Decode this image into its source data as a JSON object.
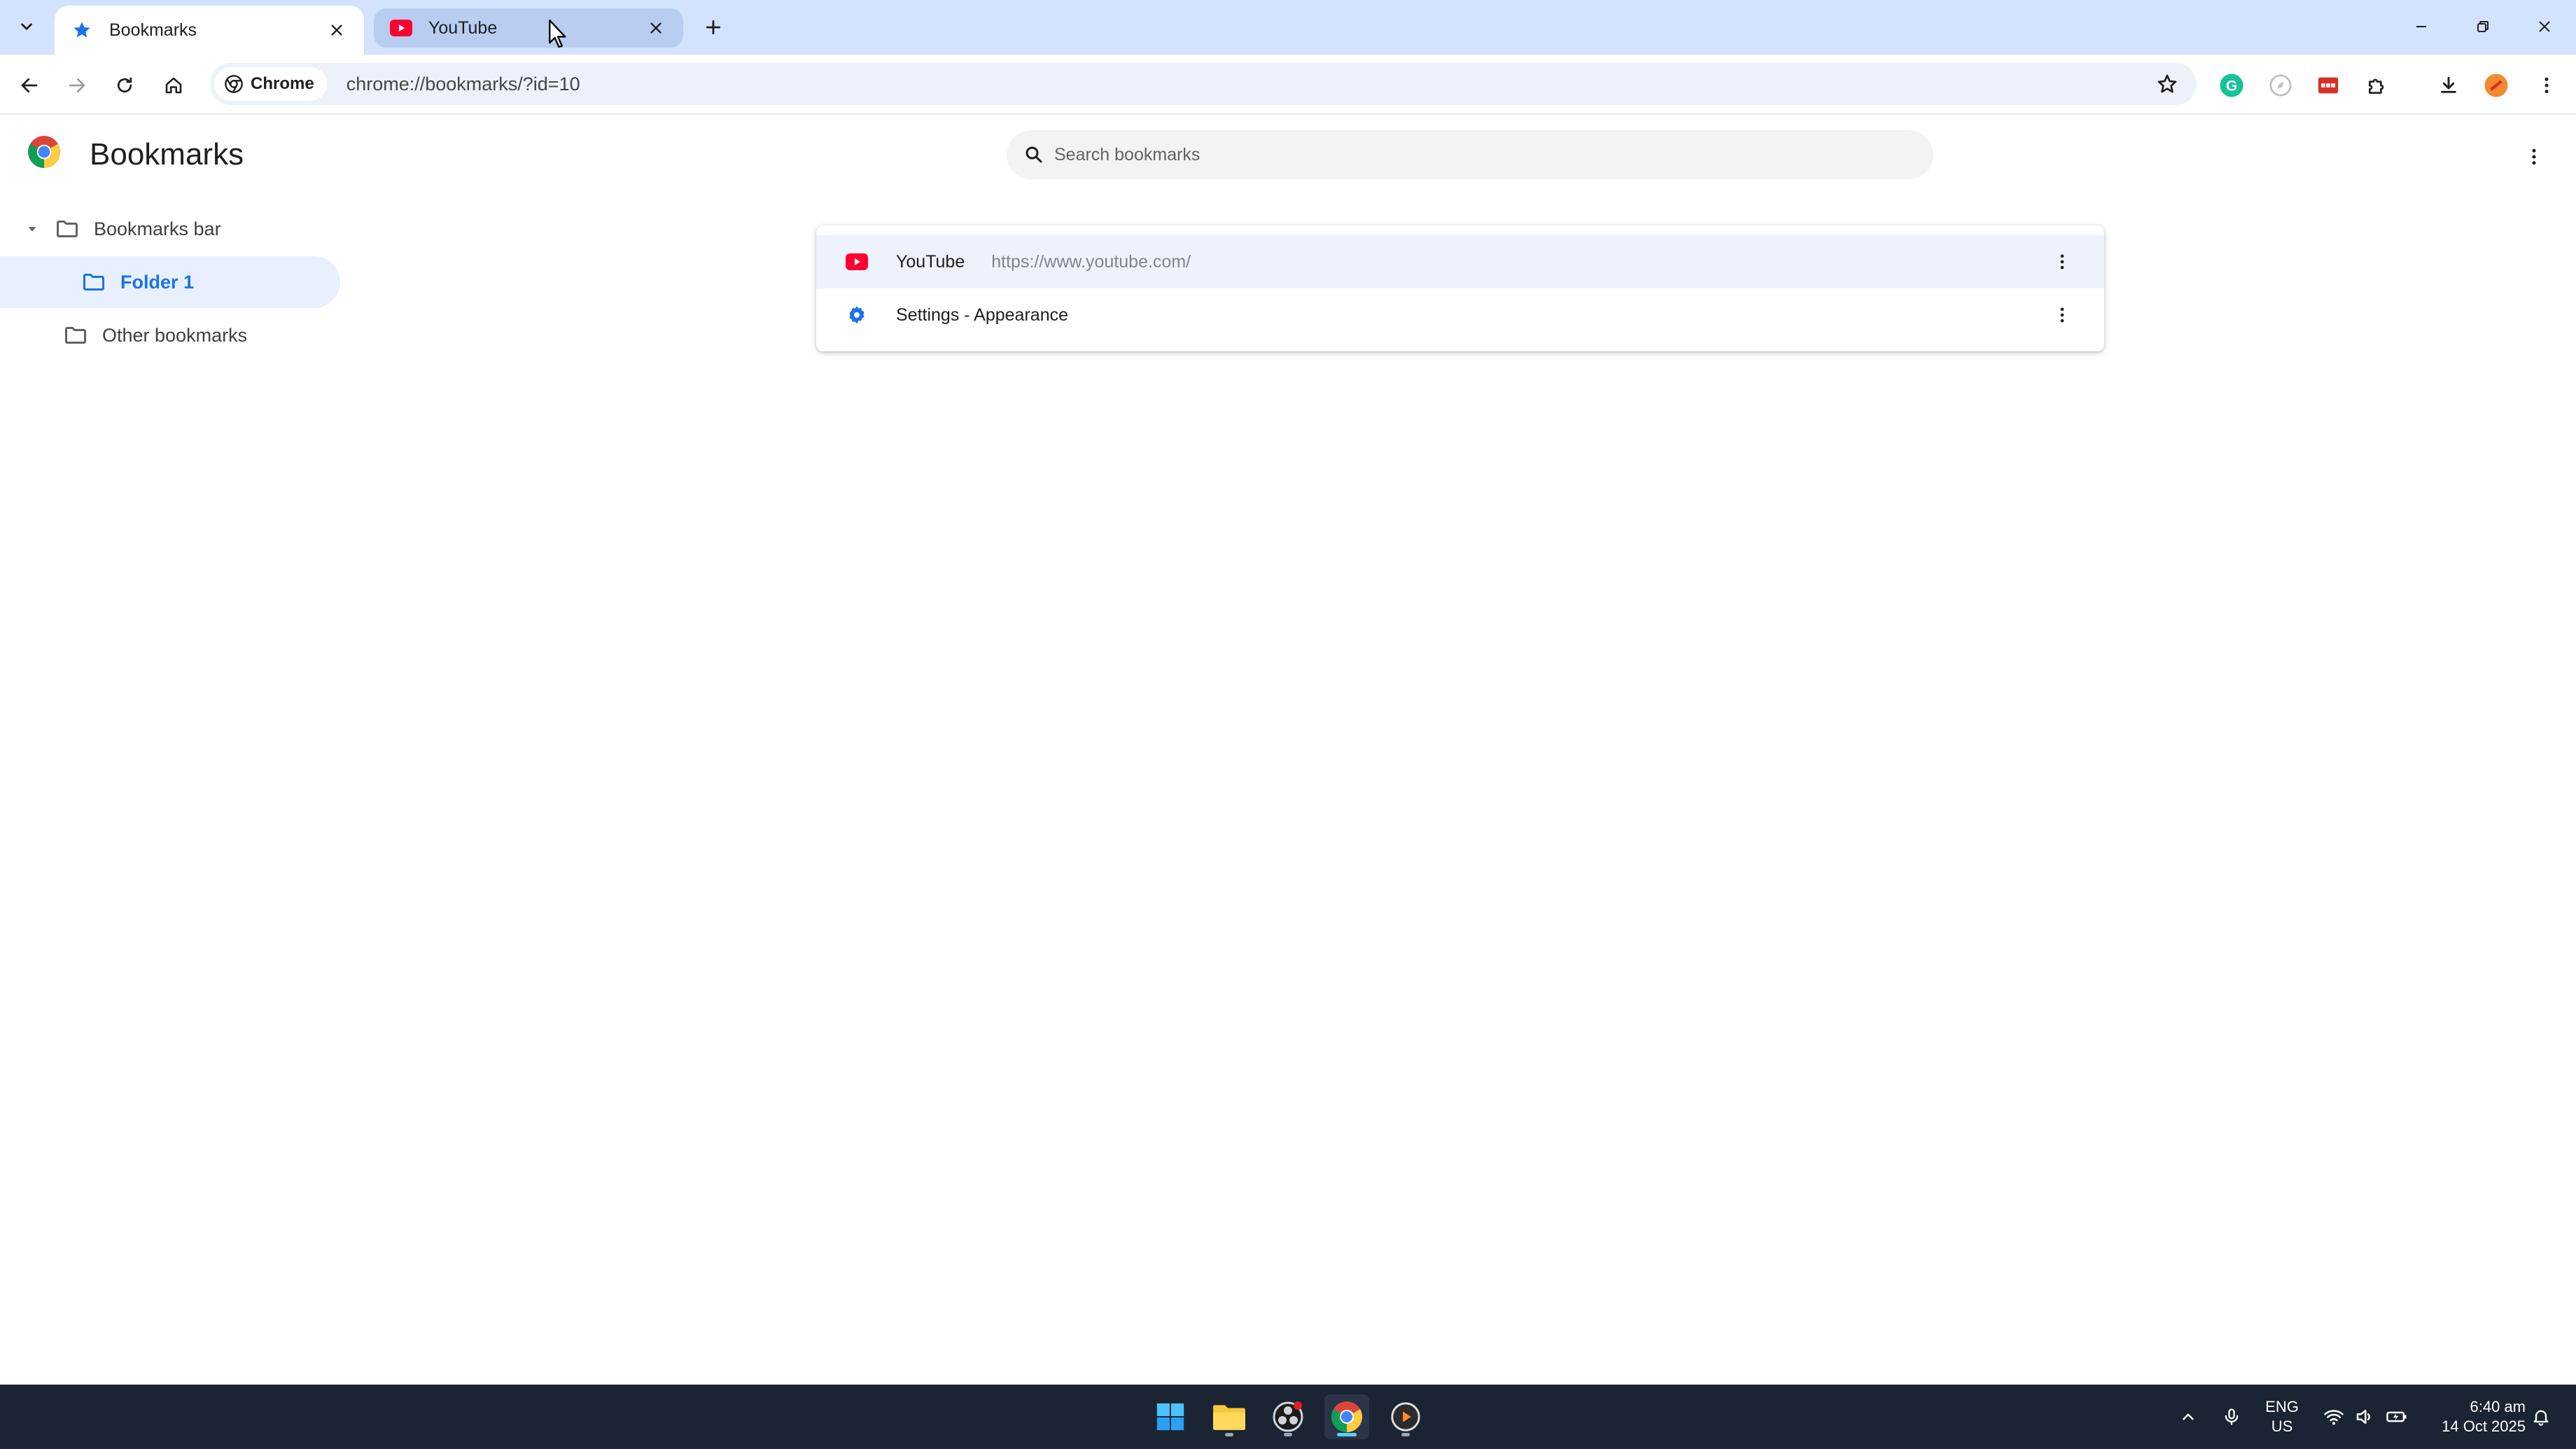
{
  "tabs": [
    {
      "title": "Bookmarks",
      "active": true
    },
    {
      "title": "YouTube",
      "active": false
    }
  ],
  "toolbar": {
    "chip_label": "Chrome",
    "url": "chrome://bookmarks/?id=10"
  },
  "page": {
    "title": "Bookmarks",
    "search_placeholder": "Search bookmarks"
  },
  "sidebar": {
    "items": [
      {
        "label": "Bookmarks bar",
        "expanded": true
      },
      {
        "label": "Folder 1",
        "selected": true
      },
      {
        "label": "Other bookmarks"
      }
    ]
  },
  "bookmarks": [
    {
      "title": "YouTube",
      "url": "https://www.youtube.com/",
      "icon": "youtube-icon"
    },
    {
      "title": "Settings - Appearance",
      "url": "",
      "icon": "settings-gear-icon"
    }
  ],
  "taskbar": {
    "lang_top": "ENG",
    "lang_bottom": "US",
    "time": "6:40 am",
    "date": "14 Oct 2025"
  },
  "colors": {
    "tabstrip": "#d3e3fd",
    "accent": "#1a73e8",
    "youtube_red": "#ff0033",
    "taskbar": "#1b2433"
  }
}
